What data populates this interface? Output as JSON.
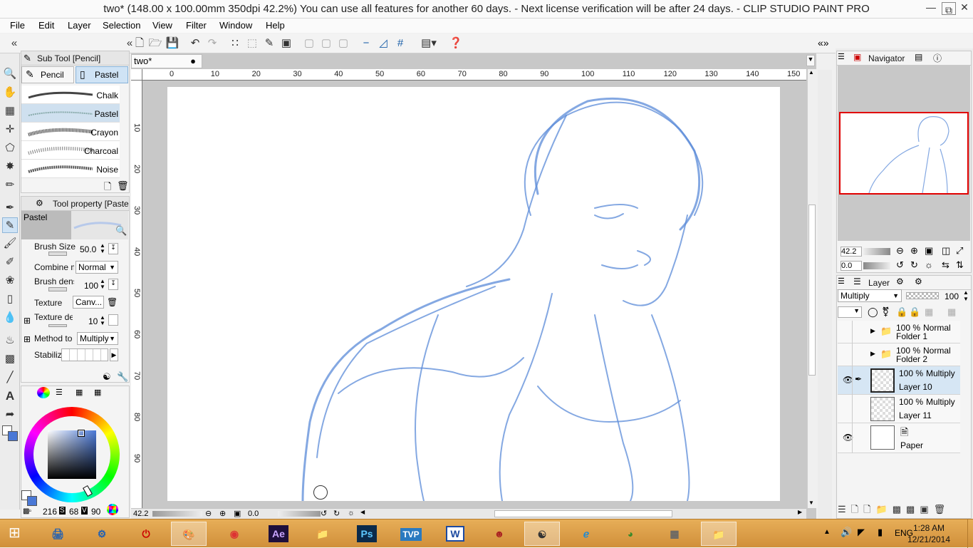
{
  "window": {
    "title": "two* (148.00 x 100.00mm 350dpi 42.2%)  You can use all features for another 60 days. - Next license verification will be after 24 days. - CLIP STUDIO PAINT PRO"
  },
  "menu": [
    "File",
    "Edit",
    "Layer",
    "Selection",
    "View",
    "Filter",
    "Window",
    "Help"
  ],
  "subtool": {
    "title": "Sub Tool [Pencil]",
    "tabs": [
      "Pencil",
      "Pastel"
    ],
    "brushes": [
      "Chalk",
      "Pastel",
      "Crayon",
      "Charcoal",
      "Noise"
    ],
    "selected": "Pastel"
  },
  "toolprop": {
    "title": "Tool property [Pastel]",
    "preview_label": "Pastel",
    "brush_size_label": "Brush Size",
    "brush_size": "50.0",
    "combine_label": "Combine m",
    "combine_value": "Normal",
    "density_label": "Brush dens",
    "density": "100",
    "texture_label": "Texture",
    "texture_value": "Canv...",
    "texture_density_label": "Texture de",
    "texture_density": "10",
    "method_label": "Method to a",
    "method_value": "Multiply",
    "stabilize_label": "Stabiliz"
  },
  "color": {
    "h": "216",
    "s": "68",
    "v": "90",
    "s_label": "S",
    "v_label": "V",
    "ring_colors": [
      "#ff0000",
      "#ffff00",
      "#00ff00",
      "#00ffff",
      "#0000ff",
      "#ff00ff"
    ],
    "square_color": "#4a78d6"
  },
  "document": {
    "tab": "two*",
    "ruler_top": [
      "0",
      "10",
      "20",
      "30",
      "40",
      "50",
      "60",
      "70",
      "80",
      "90",
      "100",
      "110",
      "120",
      "130",
      "140",
      "150"
    ],
    "ruler_left": [
      "10",
      "20",
      "30",
      "40",
      "50",
      "60",
      "70",
      "80",
      "90"
    ],
    "zoom": "42.2",
    "rotation": "0.0",
    "sketch_color": "#5b8bd8"
  },
  "navigator": {
    "title": "Navigator",
    "zoom": "42.2",
    "rotation": "0.0"
  },
  "layers": {
    "title": "Layer",
    "blend": "Multiply",
    "opacity": "100",
    "items": [
      {
        "percent": "100 %",
        "mode": "Normal",
        "name": "Folder 1",
        "type": "folder"
      },
      {
        "percent": "100 %",
        "mode": "Normal",
        "name": "Folder 2",
        "type": "folder"
      },
      {
        "percent": "100 %",
        "mode": "Multiply",
        "name": "Layer 10",
        "type": "raster"
      },
      {
        "percent": "100 %",
        "mode": "Multiply",
        "name": "Layer 11",
        "type": "raster"
      },
      {
        "name": "Paper",
        "type": "paper"
      }
    ]
  },
  "taskbar": {
    "apps": [
      "explorer-icon",
      "settings-app",
      "power-app",
      "paint-app",
      "chrome-icon",
      "after-effects",
      "file-explorer",
      "photoshop",
      "tvpaint",
      "word",
      "portrait-app",
      "clip-studio",
      "internet-explorer",
      "maps-app",
      "tile-app",
      "folder-app"
    ],
    "ae_label": "Ae",
    "ps_label": "Ps",
    "tvp_label": "TVP",
    "word_label": "W",
    "lang": "ENG",
    "time": "1:28 AM",
    "date": "12/21/2014"
  }
}
